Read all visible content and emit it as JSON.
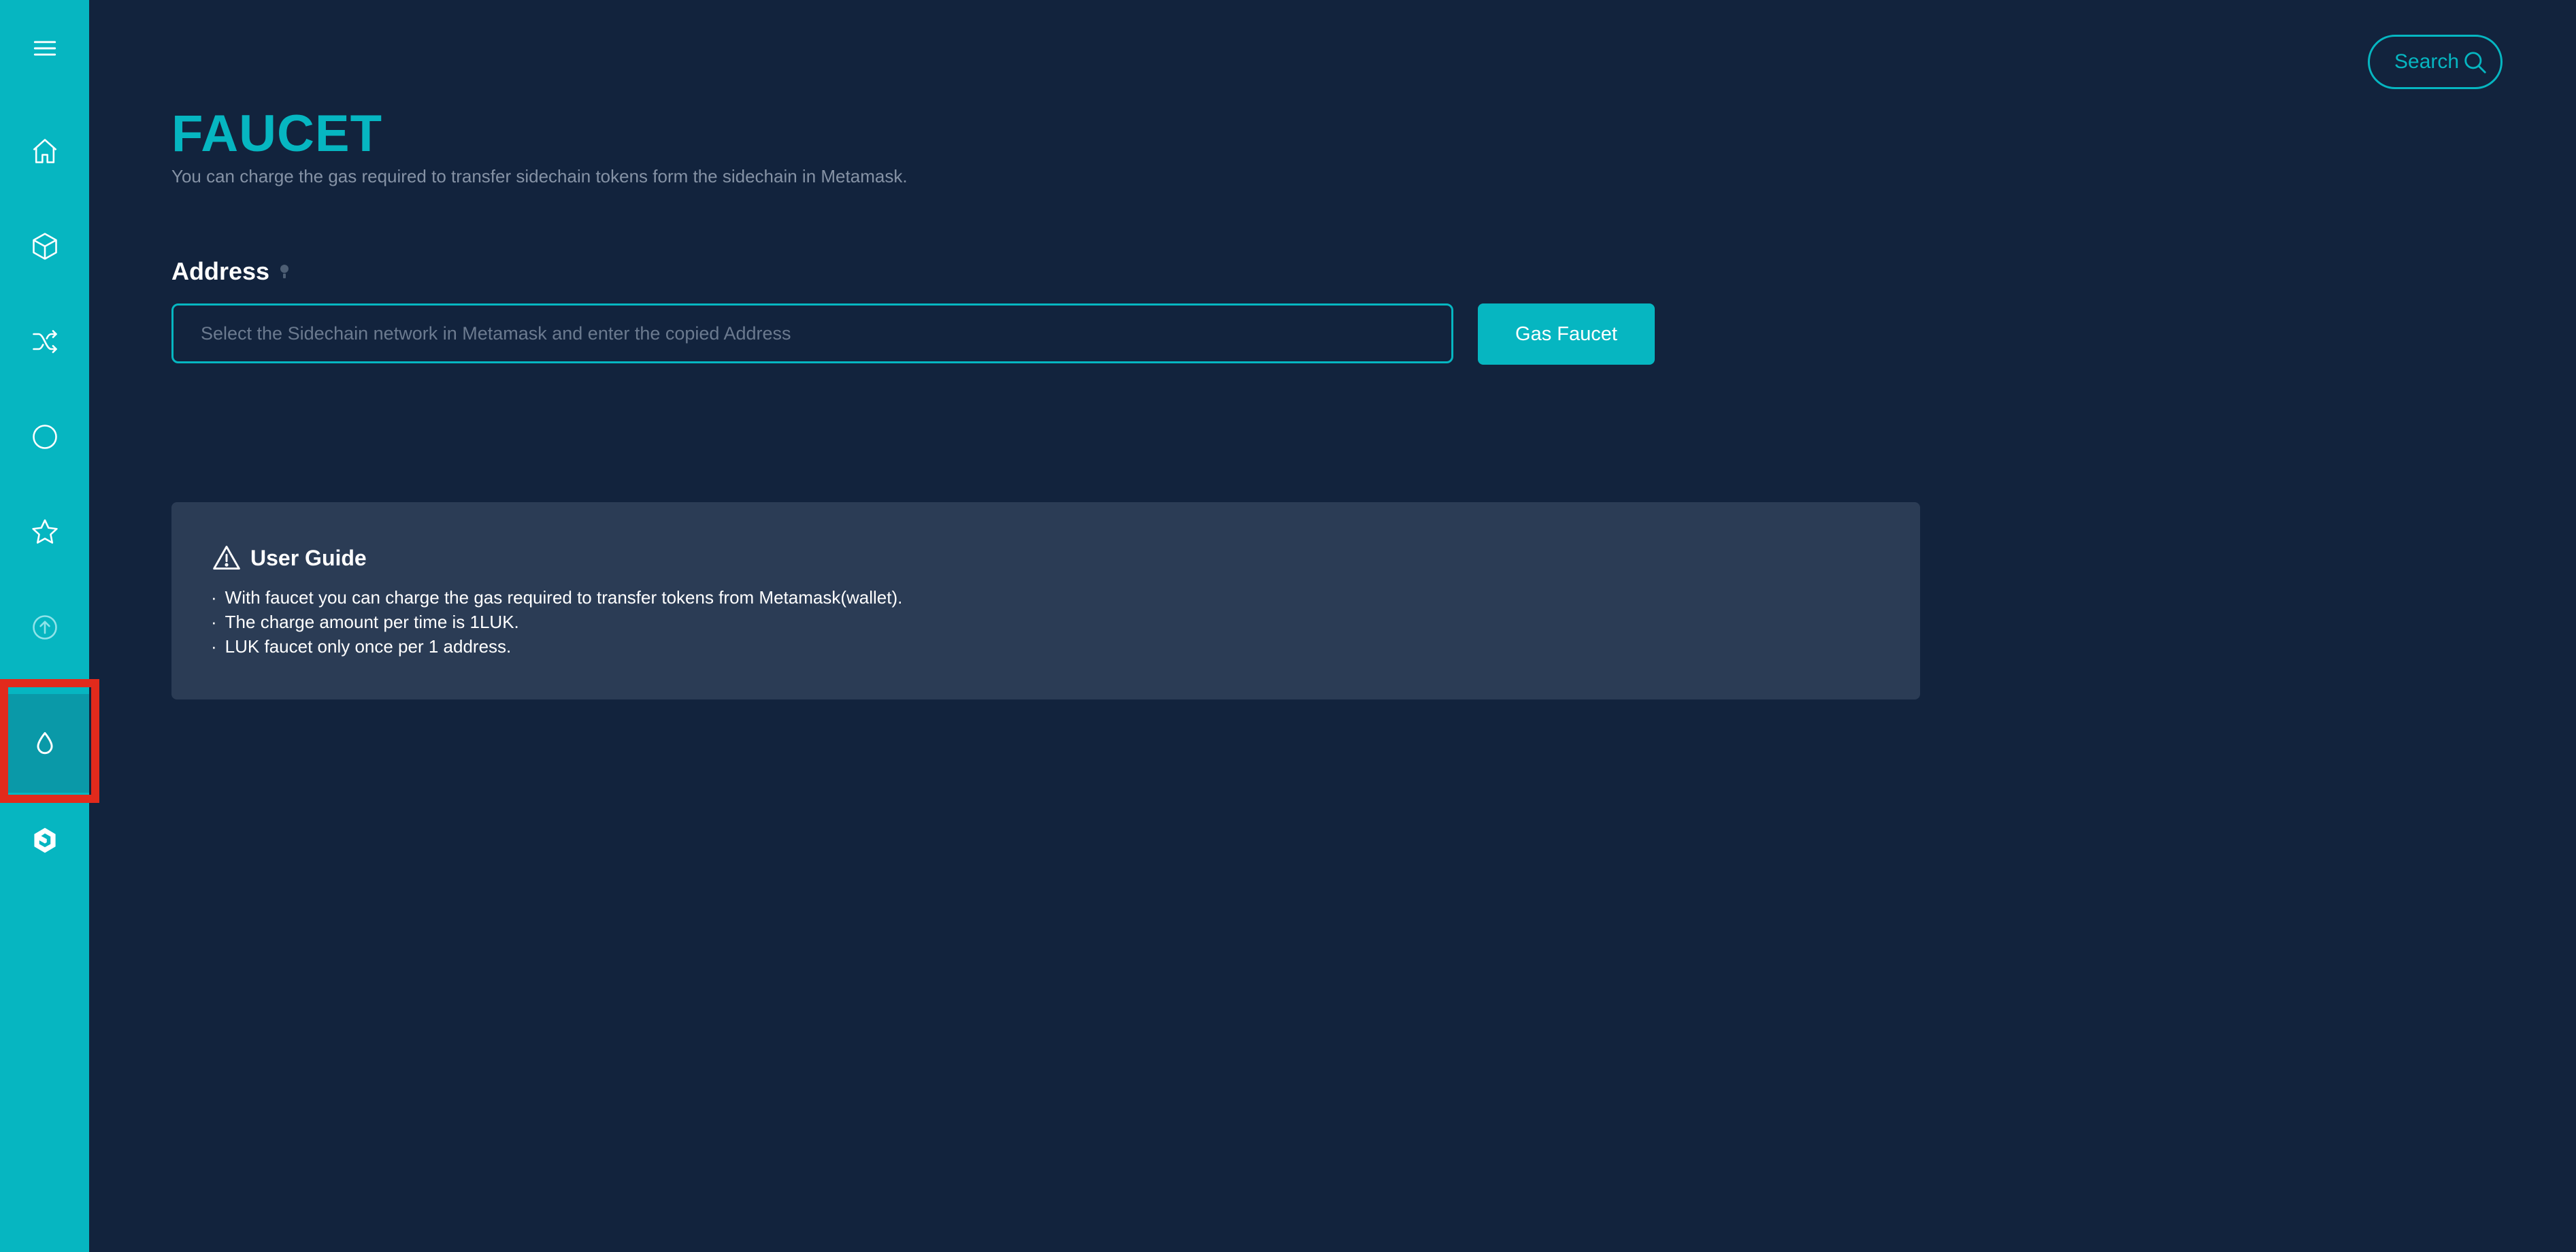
{
  "sidebar": {
    "items": [
      {
        "name": "menu-icon"
      },
      {
        "name": "home-icon"
      },
      {
        "name": "cube-icon"
      },
      {
        "name": "shuffle-icon"
      },
      {
        "name": "circle-icon"
      },
      {
        "name": "star-icon"
      },
      {
        "name": "upload-icon"
      },
      {
        "name": "droplet-icon",
        "active": true
      },
      {
        "name": "logo-icon"
      }
    ]
  },
  "header": {
    "search_label": "Search"
  },
  "page": {
    "title": "FAUCET",
    "subtitle": "You can charge the gas required to transfer sidechain tokens form the sidechain in Metamask."
  },
  "address": {
    "label": "Address",
    "value": "",
    "placeholder": "Select the Sidechain network in Metamask and enter the copied Address",
    "button_label": "Gas Faucet"
  },
  "guide": {
    "title": "User Guide",
    "items": [
      "With faucet you can charge the gas required to transfer tokens from Metamask(wallet).",
      "The charge amount per time is 1LUK.",
      "LUK faucet only once per 1 address."
    ]
  },
  "colors": {
    "accent": "#06b6c1",
    "background": "#12233d",
    "panel": "#2b3c55"
  }
}
